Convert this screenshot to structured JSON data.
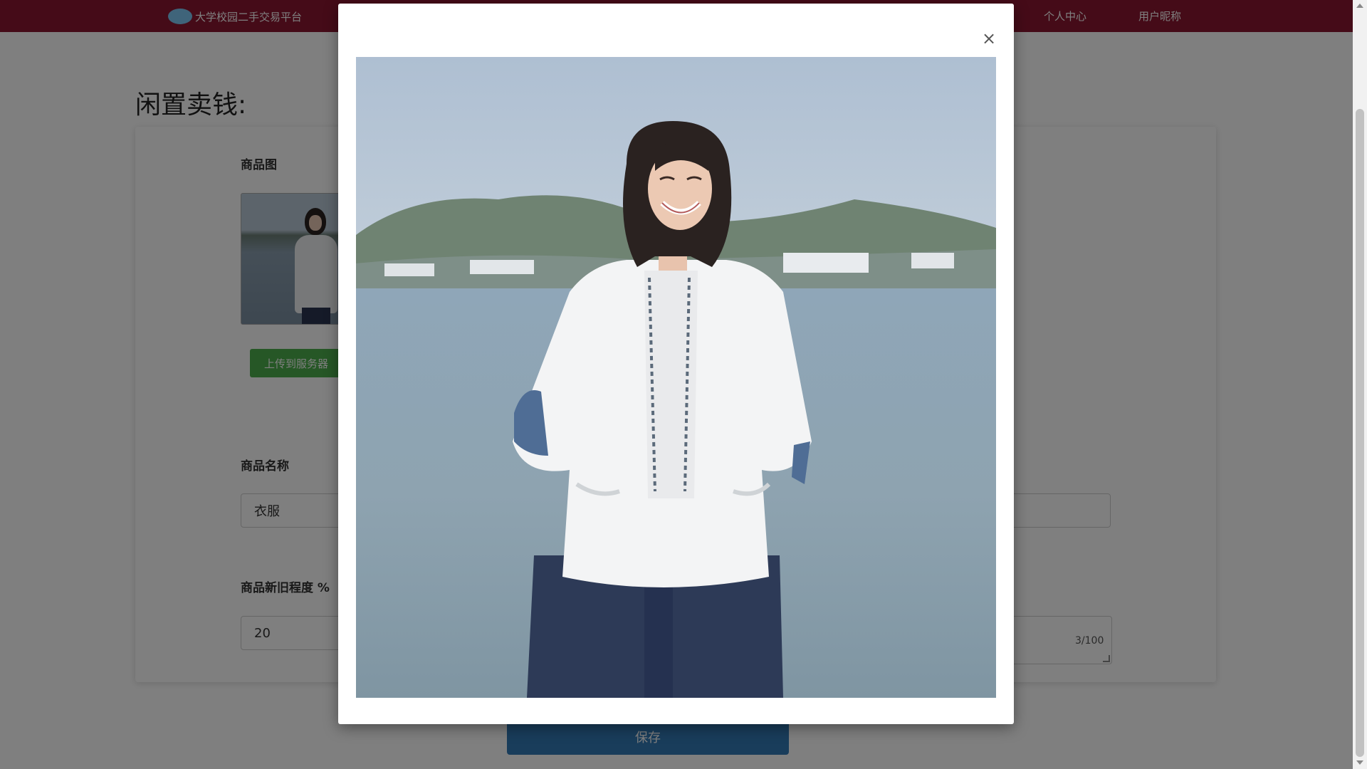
{
  "header": {
    "brand": "大学校园二手交易平台",
    "nav": [
      "个人中心",
      "用户昵称"
    ]
  },
  "page": {
    "title": "闲置卖钱:"
  },
  "form": {
    "image_label": "商品图",
    "upload_button": "上传到服务器",
    "name_label": "商品名称",
    "name_value": "衣服",
    "condition_label": "商品新旧程度 %",
    "condition_value": "20",
    "counter": "3/100",
    "save_button": "保存"
  },
  "modal": {
    "close_glyph": "×",
    "image_alt": "商品图"
  },
  "colors": {
    "header_bg": "#8a1730",
    "upload_button": "#4cae4c",
    "save_button": "#337ab7"
  },
  "icons": [
    "logo-icon",
    "close-icon"
  ]
}
